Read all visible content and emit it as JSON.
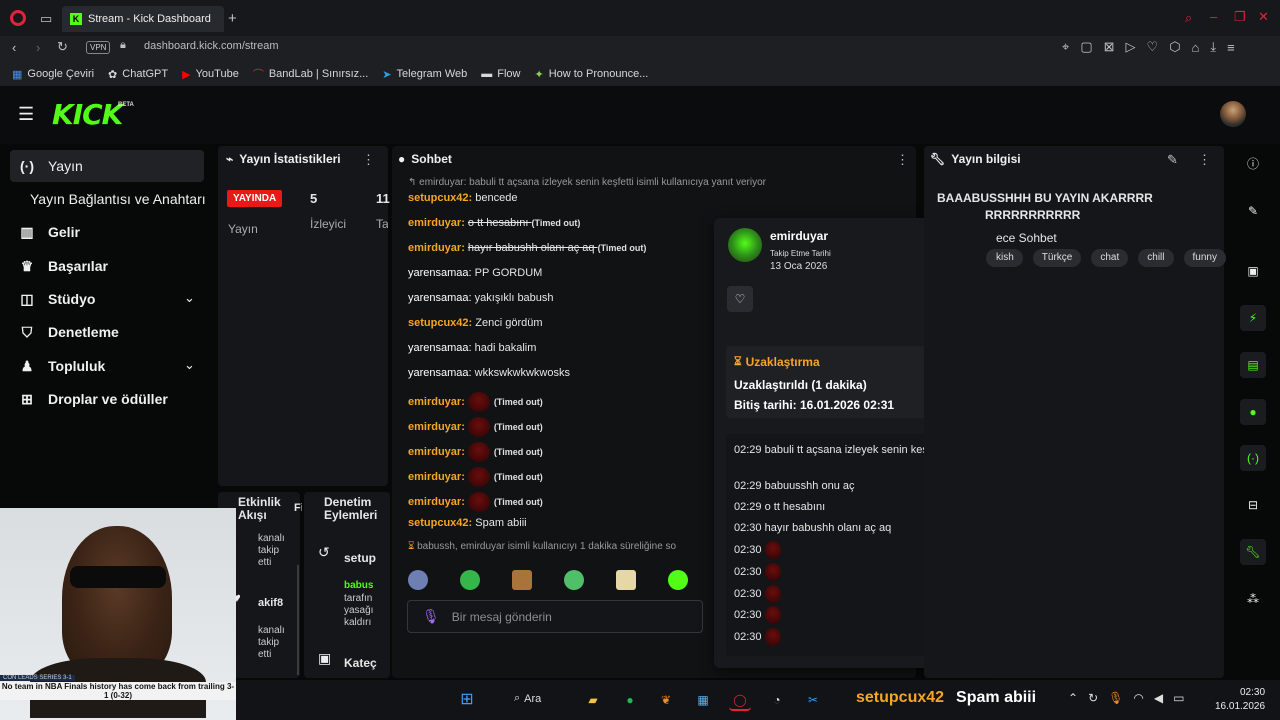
{
  "browser": {
    "tab_title": "Stream - Kick Dashboard",
    "url": "dashboard.kick.com/stream",
    "vpn_label": "VPN",
    "bookmarks": [
      {
        "label": "Google Çeviri"
      },
      {
        "label": "ChatGPT"
      },
      {
        "label": "YouTube"
      },
      {
        "label": "BandLab | Sınırsız..."
      },
      {
        "label": "Telegram Web"
      },
      {
        "label": "Flow"
      },
      {
        "label": "How to Pronounce..."
      }
    ]
  },
  "kick": {
    "logo": "KICK",
    "beta": "BETA"
  },
  "sidebar": {
    "items": [
      {
        "label": "Yayın",
        "icon": "broadcast-icon"
      },
      {
        "label": "Yayın Bağlantısı ve Anahtarı",
        "icon": ""
      },
      {
        "label": "Gelir",
        "icon": "chart-icon"
      },
      {
        "label": "Başarılar",
        "icon": "trophy-icon"
      },
      {
        "label": "Stüdyo",
        "icon": "layers-icon"
      },
      {
        "label": "Denetleme",
        "icon": "shield-icon"
      },
      {
        "label": "Topluluk",
        "icon": "users-icon"
      },
      {
        "label": "Droplar ve ödüller",
        "icon": "gift-icon"
      }
    ]
  },
  "stats": {
    "title": "Yayın İstatistikleri",
    "live_badge": "YAYINDA",
    "live_sub": "Yayın",
    "viewers_value": "5",
    "viewers_label": "İzleyici",
    "third_value": "11",
    "third_label": "Ta"
  },
  "activity": {
    "title": "Etkinlik Akışı",
    "title_extra": "Fi",
    "items": [
      {
        "text": "kanalı takip etti"
      },
      {
        "name": "akif8",
        "text": "kanalı takip etti"
      }
    ]
  },
  "mod_actions": {
    "title": "Denetim Eylemleri",
    "entry_user": "setup",
    "entry_name": "babus",
    "entry_text": "tarafın yasağı kaldırı",
    "bottom": "Kateç"
  },
  "chat": {
    "title": "Sohbet",
    "reply_notice": "emirduyar: babuli tt açsana izleyek senin keşfetti isimli kullanıcıya yanıt veriyor",
    "messages": [
      {
        "user": "setupcux42",
        "text": "bencede",
        "style": "orange"
      },
      {
        "user": "emirduyar",
        "text": "o tt hesabını",
        "suffix": "(Timed out)",
        "style": "orange",
        "strike": true
      },
      {
        "user": "emirduyar",
        "text": "hayır babushh olanı aç aq",
        "suffix": "(Timed out)",
        "style": "orange",
        "strike": true
      },
      {
        "user": "yarensamaa",
        "text": "PP GORDUM",
        "style": "white"
      },
      {
        "user": "yarensamaa",
        "text": "yakışıklı babush",
        "style": "white"
      },
      {
        "user": "setupcux42",
        "text": "Zenci gördüm",
        "style": "orange"
      },
      {
        "user": "yarensamaa",
        "text": "hadi bakalim",
        "style": "white"
      },
      {
        "user": "yarensamaa",
        "text": "wkkswkwkwkwosks",
        "style": "white"
      },
      {
        "user": "emirduyar",
        "text": "",
        "suffix": "(Timed out)",
        "style": "orange",
        "emote": true
      },
      {
        "user": "emirduyar",
        "text": "",
        "suffix": "(Timed out)",
        "style": "orange",
        "emote": true
      },
      {
        "user": "emirduyar",
        "text": "",
        "suffix": "(Timed out)",
        "style": "orange",
        "emote": true
      },
      {
        "user": "emirduyar",
        "text": "",
        "suffix": "(Timed out)",
        "style": "orange",
        "emote": true
      },
      {
        "user": "emirduyar",
        "text": "",
        "suffix": "(Timed out)",
        "style": "orange",
        "emote": true
      },
      {
        "user": "setupcux42",
        "text": "Spam abiii",
        "style": "orange"
      }
    ],
    "timeout_notice": "babussh, emirduyar isimli kullanıcıyı 1 dakika süreliğine so",
    "input_placeholder": "Bir mesaj gönderin"
  },
  "user_card": {
    "username": "emirduyar",
    "follow_label": "Takip Etme Tarihi",
    "follow_date": "13 Oca 2026",
    "timeout_title": "Uzaklaştırma",
    "timeout_status": "Uzaklaştırıldı (1 dakika)",
    "timeout_end": "Bitiş tarihi: 16.01.2026 02:31",
    "log": [
      {
        "time": "02:29",
        "text": "babuli tt açsana izleyek senin keşfetti"
      },
      {
        "time": "02:29",
        "text": "babuusshh onu aç"
      },
      {
        "time": "02:29",
        "text": "o tt hesabını"
      },
      {
        "time": "02:30",
        "text": "hayır babushh olanı aç aq"
      },
      {
        "time": "02:30",
        "text": ""
      },
      {
        "time": "02:30",
        "text": ""
      },
      {
        "time": "02:30",
        "text": ""
      },
      {
        "time": "02:30",
        "text": ""
      },
      {
        "time": "02:30",
        "text": ""
      }
    ]
  },
  "stream_info": {
    "title": "Yayın bilgisi",
    "stream_title_line1": "BAAABUSSHHH BU YAYIN AKARRRR",
    "stream_title_line2": "RRRRRRRRRRR",
    "category": "ece Sohbet",
    "tags": [
      "kish",
      "Türkçe",
      "chat",
      "chill",
      "funny"
    ]
  },
  "webcam": {
    "ticker_top": "CON LEADS SERIES 3-1",
    "ticker_text": "No team in NBA Finals history has come back from trailing 3-1 (0-32)"
  },
  "taskbar": {
    "search_label": "Ara",
    "overlay_user": "setupcux42",
    "overlay_msg": "Spam abiii",
    "clock_time": "02:30",
    "clock_date": "16.01.2026"
  }
}
